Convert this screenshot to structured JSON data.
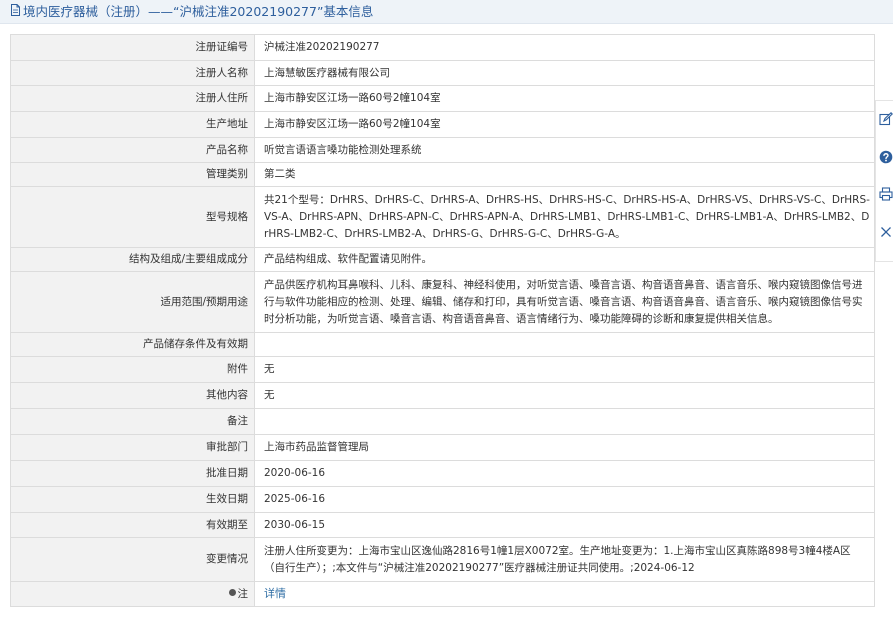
{
  "header": {
    "title": "境内医疗器械（注册）——“沪械注准20202190277”基本信息"
  },
  "rows": [
    {
      "label": "注册证编号",
      "value": "沪械注准20202190277"
    },
    {
      "label": "注册人名称",
      "value": "上海慧敏医疗器械有限公司"
    },
    {
      "label": "注册人住所",
      "value": "上海市静安区江场一路60号2幢104室"
    },
    {
      "label": "生产地址",
      "value": "上海市静安区江场一路60号2幢104室"
    },
    {
      "label": "产品名称",
      "value": "听觉言语语言嗓功能检测处理系统"
    },
    {
      "label": "管理类别",
      "value": "第二类"
    },
    {
      "label": "型号规格",
      "value": "共21个型号：DrHRS、DrHRS-C、DrHRS-A、DrHRS-HS、DrHRS-HS-C、DrHRS-HS-A、DrHRS-VS、DrHRS-VS-C、DrHRS-VS-A、DrHRS-APN、DrHRS-APN-C、DrHRS-APN-A、DrHRS-LMB1、DrHRS-LMB1-C、DrHRS-LMB1-A、DrHRS-LMB2、DrHRS-LMB2-C、DrHRS-LMB2-A、DrHRS-G、DrHRS-G-C、DrHRS-G-A。"
    },
    {
      "label": "结构及组成/主要组成成分",
      "value": "产品结构组成、软件配置请见附件。"
    },
    {
      "label": "适用范围/预期用途",
      "value": "产品供医疗机构耳鼻喉科、儿科、康复科、神经科使用，对听觉言语、嗓音言语、构音语音鼻音、语言音乐、喉内窥镜图像信号进行与软件功能相应的检测、处理、编辑、储存和打印，具有听觉言语、嗓音言语、构音语音鼻音、语言音乐、喉内窥镜图像信号实时分析功能，为听觉言语、嗓音言语、构音语音鼻音、语言情绪行为、嗓功能障碍的诊断和康复提供相关信息。"
    },
    {
      "label": "产品储存条件及有效期",
      "value": ""
    },
    {
      "label": "附件",
      "value": "无"
    },
    {
      "label": "其他内容",
      "value": "无"
    },
    {
      "label": "备注",
      "value": ""
    },
    {
      "label": "审批部门",
      "value": "上海市药品监督管理局"
    },
    {
      "label": "批准日期",
      "value": "2020-06-16"
    },
    {
      "label": "生效日期",
      "value": "2025-06-16"
    },
    {
      "label": "有效期至",
      "value": "2030-06-15"
    },
    {
      "label": "变更情况",
      "value": "注册人住所变更为：上海市宝山区逸仙路2816号1幢1层X0072室。生产地址变更为：1.上海市宝山区真陈路898号3幢4楼A区（自行生产）；;本文件与“沪械注准20202190277”医疗器械注册证共同使用。;2024-06-12"
    }
  ],
  "note": {
    "label": "注",
    "link": "详情"
  },
  "side_tools": [
    {
      "icon": "edit-icon"
    },
    {
      "icon": "help-icon"
    },
    {
      "icon": "print-icon"
    },
    {
      "icon": "close-icon"
    }
  ],
  "colors": {
    "accent": "#2e5f9d",
    "label_bg": "#f2f2f2",
    "border": "#dcdcdc",
    "link": "#2e6da4"
  }
}
